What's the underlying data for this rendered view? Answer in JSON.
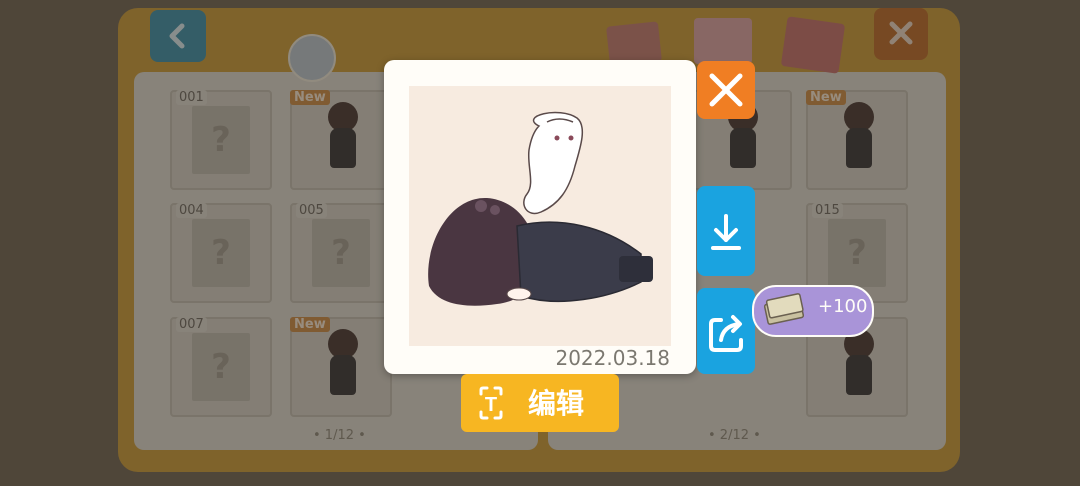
{
  "album": {
    "left_page": {
      "slots": [
        {
          "num": "001",
          "state": "locked"
        },
        {
          "num": "",
          "state": "unlocked",
          "badge": "New"
        },
        {
          "num": "004",
          "state": "locked"
        },
        {
          "num": "005",
          "state": "locked"
        },
        {
          "num": "007",
          "state": "locked"
        },
        {
          "num": "",
          "state": "unlocked",
          "badge": "New"
        }
      ],
      "page_indicator": "• 1/12 •"
    },
    "right_page": {
      "slots": [
        {
          "num": "",
          "state": "unlocked",
          "badge": ""
        },
        {
          "num": "",
          "state": "unlocked",
          "badge": "New"
        },
        {
          "num": "015",
          "state": "locked"
        },
        {
          "num": "",
          "state": "unlocked",
          "badge": ""
        }
      ],
      "page_indicator": "• 2/12 •"
    },
    "locked_symbol": "?"
  },
  "photo_modal": {
    "date": "2022.03.18",
    "edit_button_label": "编辑",
    "edit_icon_letter": "T",
    "share_reward": "+100"
  },
  "colors": {
    "close": "#f07e23",
    "action_blue": "#1aa3e0",
    "edit_yellow": "#f7b622",
    "reward_purple": "#a994d8",
    "album_gold": "#c79a3a"
  },
  "icons": {
    "back": "chevron-left-icon",
    "close": "x-icon",
    "download": "download-icon",
    "share": "share-icon",
    "edit": "text-edit-icon",
    "reward": "cash-stack-icon"
  }
}
